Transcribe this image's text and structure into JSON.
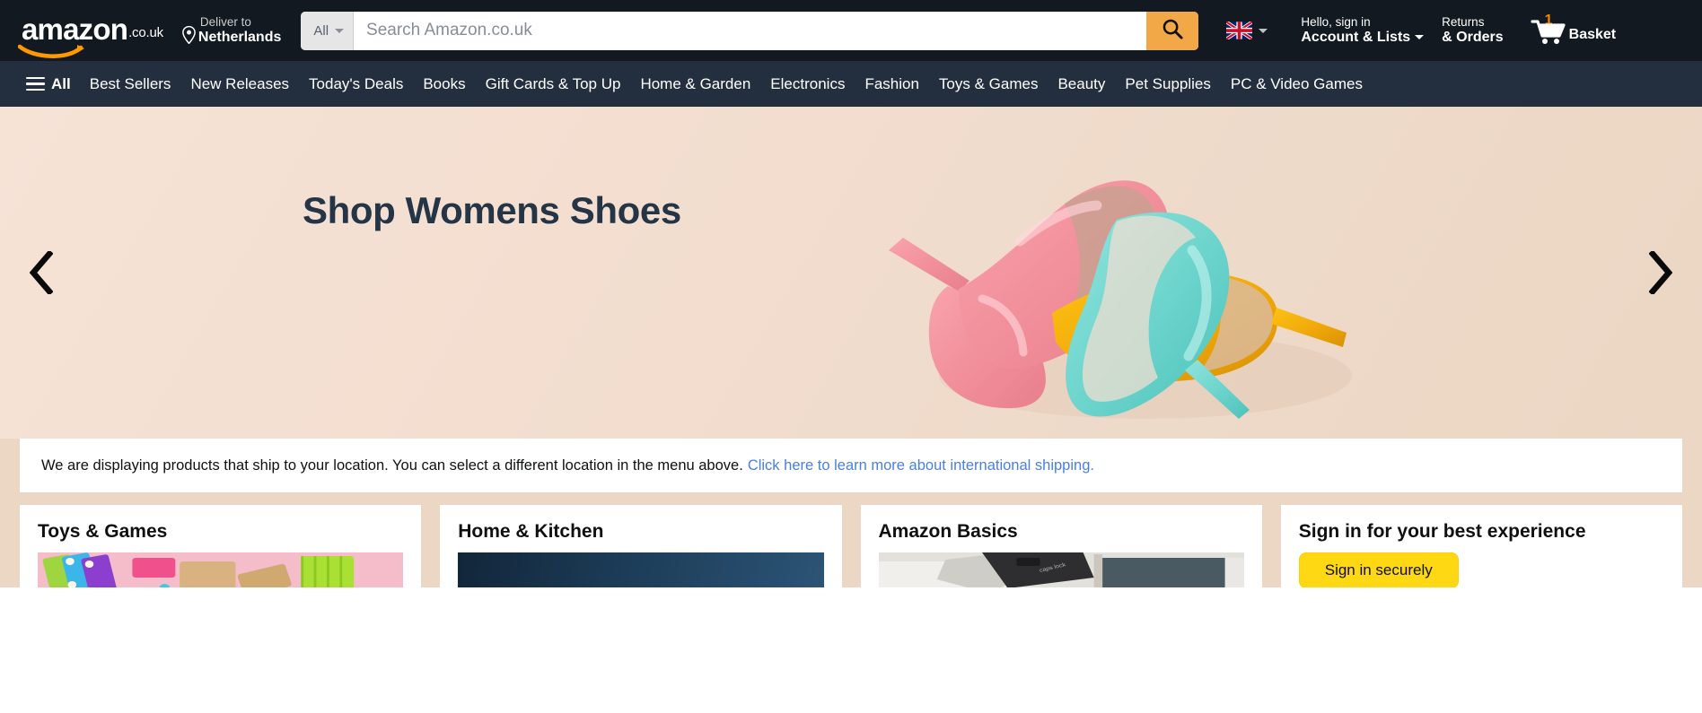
{
  "header": {
    "logo_word": "amazon",
    "logo_tld": ".co.uk",
    "deliver_label": "Deliver to",
    "deliver_country": "Netherlands",
    "deliver_pin_icon": "location-pin-icon",
    "search": {
      "category_selected": "All",
      "placeholder": "Search Amazon.co.uk",
      "value": "",
      "submit_icon": "search-icon"
    },
    "flag_icon": "uk-flag-icon",
    "account": {
      "line1": "Hello, sign in",
      "line2": "Account & Lists"
    },
    "returns": {
      "line1": "Returns",
      "line2": "& Orders"
    },
    "basket": {
      "count": "1",
      "label": "Basket",
      "icon": "shopping-cart-icon"
    },
    "colors": {
      "bar": "#131921",
      "subbar": "#232f3e",
      "search_button": "#f3a847"
    }
  },
  "subnav": {
    "all_label": "All",
    "menu_icon": "hamburger-menu-icon",
    "items": [
      {
        "label": "Best Sellers"
      },
      {
        "label": "New Releases"
      },
      {
        "label": "Today's Deals"
      },
      {
        "label": "Books"
      },
      {
        "label": "Gift Cards & Top Up"
      },
      {
        "label": "Home & Garden"
      },
      {
        "label": "Electronics"
      },
      {
        "label": "Fashion"
      },
      {
        "label": "Toys & Games"
      },
      {
        "label": "Beauty"
      },
      {
        "label": "Pet Supplies"
      },
      {
        "label": "PC & Video Games"
      }
    ]
  },
  "hero": {
    "title": "Shop Womens Shoes",
    "prev_icon": "chevron-left-icon",
    "next_icon": "chevron-right-icon",
    "background_color": "#f0dbcb",
    "title_color": "#253546",
    "image_alt": "three high-heel shoes pink yellow turquoise"
  },
  "notice": {
    "text": "We are displaying products that ship to your location. You can select a different location in the menu above.",
    "link_text": "Click here to learn more about international shipping.",
    "link_color": "#4a7fe0"
  },
  "cards": [
    {
      "title": "Toys & Games",
      "media": "toys-photo"
    },
    {
      "title": "Home & Kitchen",
      "media": "kitchen-photo"
    },
    {
      "title": "Amazon Basics",
      "media": "basics-photo"
    },
    {
      "title": "Sign in for your best experience",
      "button_label": "Sign in securely",
      "button_color": "#ffd814"
    }
  ]
}
